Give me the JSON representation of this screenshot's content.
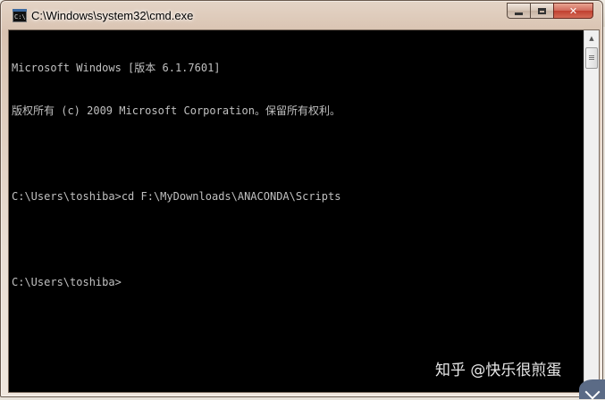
{
  "window": {
    "title": "C:\\Windows\\system32\\cmd.exe",
    "icon_text": "C:\\."
  },
  "console": {
    "lines": [
      "Microsoft Windows [版本 6.1.7601]",
      "版权所有 (c) 2009 Microsoft Corporation。保留所有权利。",
      "",
      "C:\\Users\\toshiba>cd F:\\MyDownloads\\ANACONDA\\Scripts",
      "",
      "C:\\Users\\toshiba>"
    ]
  },
  "watermark": "知乎 @快乐很煎蛋",
  "icons": {
    "app": "cmd-icon",
    "minimize": "minimize-icon",
    "maximize": "maximize-icon",
    "close": "close-icon",
    "scroll_up": "scroll-up-arrow-icon",
    "corner": "chevron-icon"
  }
}
